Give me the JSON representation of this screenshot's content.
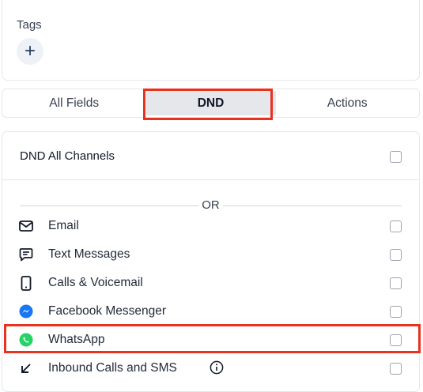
{
  "tags": {
    "label": "Tags",
    "add_symbol": "+"
  },
  "tabs": [
    {
      "label": "All Fields",
      "active": false
    },
    {
      "label": "DND",
      "active": true
    },
    {
      "label": "Actions",
      "active": false
    }
  ],
  "dnd": {
    "all_channels_label": "DND All Channels",
    "all_channels_checked": false,
    "separator": "OR",
    "channels": [
      {
        "label": "Email",
        "icon": "envelope-icon",
        "checked": false
      },
      {
        "label": "Text Messages",
        "icon": "message-icon",
        "checked": false
      },
      {
        "label": "Calls & Voicemail",
        "icon": "phone-icon",
        "checked": false
      },
      {
        "label": "Facebook Messenger",
        "icon": "messenger-icon",
        "checked": false
      },
      {
        "label": "WhatsApp",
        "icon": "whatsapp-icon",
        "checked": false
      },
      {
        "label": "Inbound Calls and SMS",
        "icon": "arrow-down-left-icon",
        "checked": false,
        "info_icon": "info-icon"
      }
    ]
  },
  "colors": {
    "highlight": "#e8321e",
    "messenger": "#1877f2",
    "whatsapp": "#25d366",
    "active_tab_bg": "#e5e7eb"
  }
}
